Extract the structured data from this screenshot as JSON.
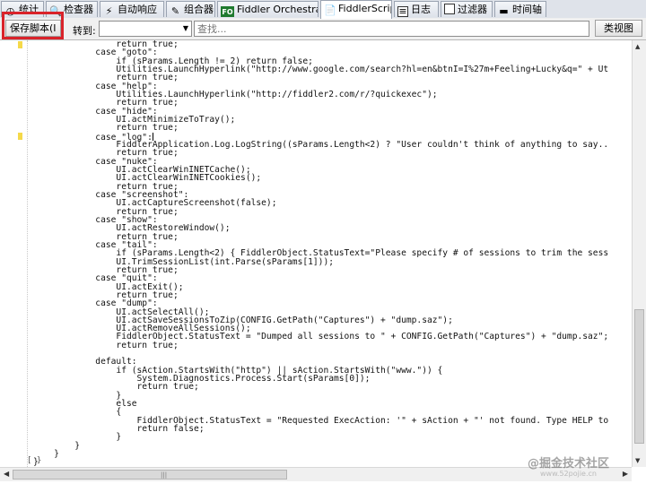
{
  "tabs": [
    {
      "label": "统计",
      "icon": "timer-icon"
    },
    {
      "label": "检查器",
      "icon": "inspect-icon"
    },
    {
      "label": "自动响应",
      "icon": "lightning-icon"
    },
    {
      "label": "组合器",
      "icon": "compose-icon"
    },
    {
      "label": "Fiddler Orchestra Beta",
      "icon": "fo-icon",
      "icon_text": "FO"
    },
    {
      "label": "FiddlerScript",
      "icon": "script-icon"
    },
    {
      "label": "日志",
      "icon": "log-icon"
    },
    {
      "label": "过滤器",
      "icon": "filter-checkbox-icon"
    },
    {
      "label": "时间轴",
      "icon": "timeline-icon"
    }
  ],
  "toolbar": {
    "save_label": "保存脚本(I",
    "goto_label": "转到:",
    "goto_value": "",
    "search_placeholder": "查找...",
    "view_label": "类视图"
  },
  "code_lines": [
    "                return true;",
    "            case \"goto\":",
    "                if (sParams.Length != 2) return false;",
    "                Utilities.LaunchHyperlink(\"http://www.google.com/search?hl=en&btnI=I%27m+Feeling+Lucky&q=\" + Ut",
    "                return true;",
    "            case \"help\":",
    "                Utilities.LaunchHyperlink(\"http://fiddler2.com/r/?quickexec\");",
    "                return true;",
    "            case \"hide\":",
    "                UI.actMinimizeToTray();",
    "                return true;",
    "            case \"log\":",
    "                FiddlerApplication.Log.LogString((sParams.Length<2) ? \"User couldn't think of anything to say..",
    "                return true;",
    "            case \"nuke\":",
    "                UI.actClearWinINETCache();",
    "                UI.actClearWinINETCookies();",
    "                return true;",
    "            case \"screenshot\":",
    "                UI.actCaptureScreenshot(false);",
    "                return true;",
    "            case \"show\":",
    "                UI.actRestoreWindow();",
    "                return true;",
    "            case \"tail\":",
    "                if (sParams.Length<2) { FiddlerObject.StatusText=\"Please specify # of sessions to trim the sess",
    "                UI.TrimSessionList(int.Parse(sParams[1]));",
    "                return true;",
    "            case \"quit\":",
    "                UI.actExit();",
    "                return true;",
    "            case \"dump\":",
    "                UI.actSelectAll();",
    "                UI.actSaveSessionsToZip(CONFIG.GetPath(\"Captures\") + \"dump.saz\");",
    "                UI.actRemoveAllSessions();",
    "                FiddlerObject.StatusText = \"Dumped all sessions to \" + CONFIG.GetPath(\"Captures\") + \"dump.saz\";",
    "                return true;",
    "",
    "            default:",
    "                if (sAction.StartsWith(\"http\") || sAction.StartsWith(\"www.\")) {",
    "                    System.Diagnostics.Process.Start(sParams[0]);",
    "                    return true;",
    "                }",
    "                else",
    "                {",
    "                    FiddlerObject.StatusText = \"Requested ExecAction: '\" + sAction + \"' not found. Type HELP to",
    "                    return false;",
    "                }",
    "        }",
    "    }",
    "}"
  ],
  "watermark": "@掘金技术社区",
  "watermark_small": "www.52pojie.cn"
}
